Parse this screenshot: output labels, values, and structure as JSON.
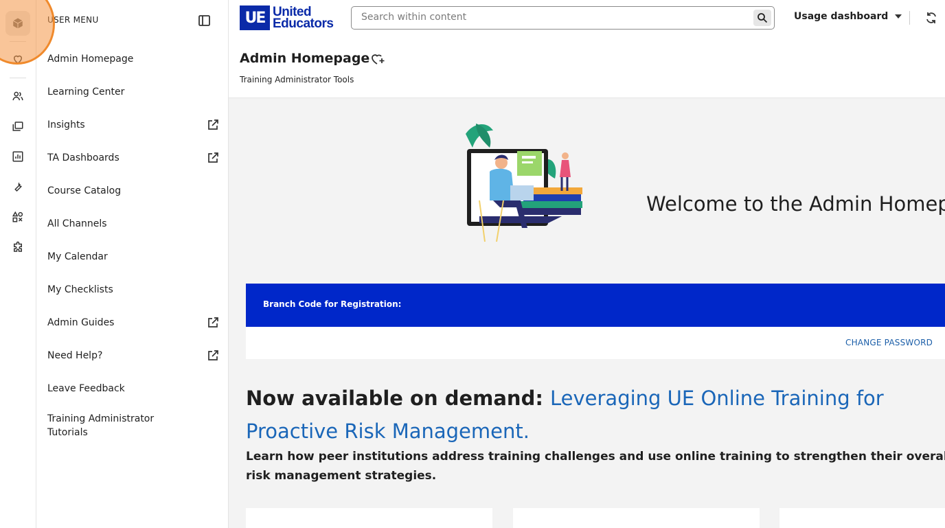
{
  "colors": {
    "brand_blue": "#0a2aa8",
    "branch_bar": "#0027c9",
    "link_blue": "#1a66b8",
    "highlight_orange": "#f08a2c"
  },
  "rail": {
    "icons": [
      "cube-icon",
      "heart-icon",
      "users-icon",
      "folders-icon",
      "chart-icon",
      "wrench-icon",
      "shapes-icon",
      "puzzle-icon"
    ]
  },
  "menu": {
    "title": "USER MENU",
    "items": [
      {
        "label": "Admin Homepage",
        "external": false
      },
      {
        "label": "Learning Center",
        "external": false
      },
      {
        "label": "Insights",
        "external": true
      },
      {
        "label": "TA Dashboards",
        "external": true
      },
      {
        "label": "Course Catalog",
        "external": false
      },
      {
        "label": "All Channels",
        "external": false
      },
      {
        "label": "My Calendar",
        "external": false
      },
      {
        "label": "My Checklists",
        "external": false
      },
      {
        "label": "Admin Guides",
        "external": true
      },
      {
        "label": "Need Help?",
        "external": true
      },
      {
        "label": "Leave Feedback",
        "external": false
      },
      {
        "label": "Training Administrator Tutorials",
        "external": false
      }
    ]
  },
  "header": {
    "logo_mark": "UE",
    "logo_line1": "United",
    "logo_line2": "Educators",
    "search_placeholder": "Search within content",
    "dashboard_select": "Usage dashboard",
    "page_title": "Admin Homepage",
    "page_subtitle": "Training Administrator Tools"
  },
  "main": {
    "welcome": "Welcome to the Admin Homepage",
    "branch_label": "Branch Code for Registration:",
    "change_password": "CHANGE PASSWORD",
    "headline_prefix": "Now available on demand: ",
    "headline_link": "Leveraging UE Online Training for Proactive Risk Management.",
    "blurb": "Learn how peer institutions address training challenges and use online training to strengthen their overall risk management strategies."
  }
}
